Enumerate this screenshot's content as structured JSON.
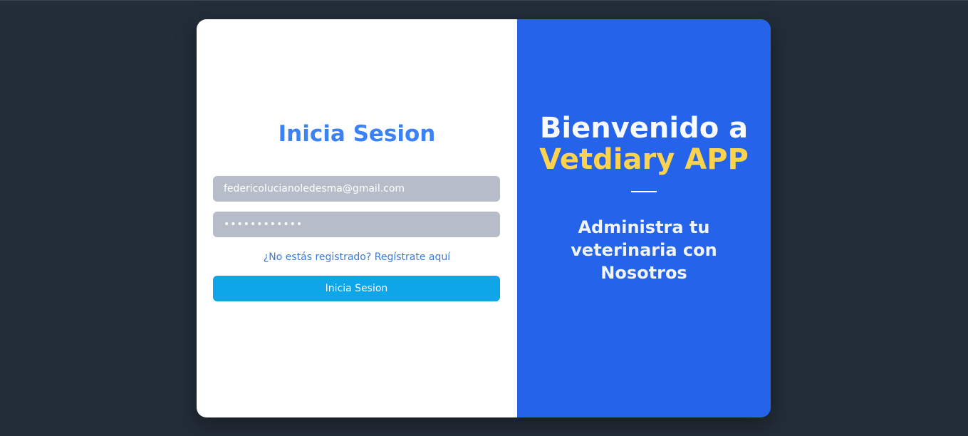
{
  "login": {
    "title": "Inicia Sesion",
    "email_value": "federicolucianoledesma@gmail.com",
    "password_value": "••••••••••••",
    "register_link": "¿No estás registrado? Regístrate aquí",
    "submit_label": "Inicia Sesion"
  },
  "welcome": {
    "line1": "Bienvenido a",
    "line2": "Vetdiary APP",
    "tagline": "Administra tu veterinaria con Nosotros"
  },
  "colors": {
    "background": "#232d38",
    "panel_blue": "#2563eb",
    "title_blue": "#3b82f6",
    "button_blue": "#0ea5e9",
    "accent_yellow": "#fcd34d",
    "input_gray": "#b6bdc8"
  }
}
